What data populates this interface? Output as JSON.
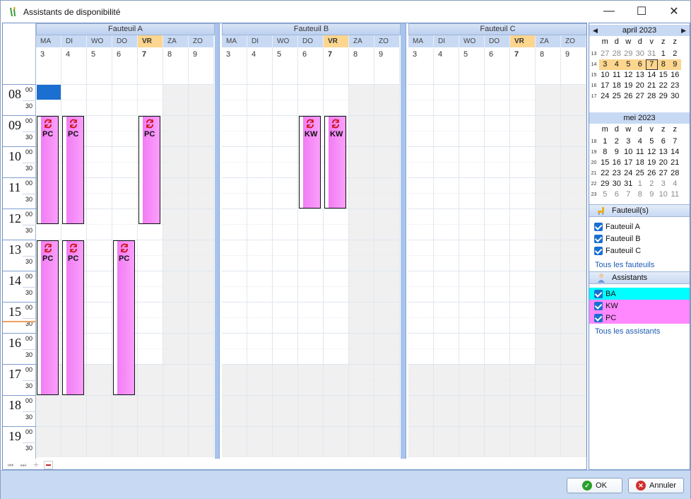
{
  "window": {
    "title": "Assistants de disponibilité",
    "minimize_glyph": "—",
    "maximize_glyph": "☐",
    "close_glyph": "✕"
  },
  "scheduler": {
    "groups": [
      {
        "label": "Fauteuil A"
      },
      {
        "label": "Fauteuil B"
      },
      {
        "label": "Fauteuil C"
      }
    ],
    "days": [
      {
        "abbr": "MA",
        "num": "3",
        "today": false,
        "weekend": false
      },
      {
        "abbr": "DI",
        "num": "4",
        "today": false,
        "weekend": false
      },
      {
        "abbr": "WO",
        "num": "5",
        "today": false,
        "weekend": false
      },
      {
        "abbr": "DO",
        "num": "6",
        "today": false,
        "weekend": false
      },
      {
        "abbr": "VR",
        "num": "7",
        "today": true,
        "weekend": false
      },
      {
        "abbr": "ZA",
        "num": "8",
        "today": false,
        "weekend": true
      },
      {
        "abbr": "ZO",
        "num": "9",
        "today": false,
        "weekend": true
      }
    ],
    "hours": [
      "08",
      "09",
      "10",
      "11",
      "12",
      "13",
      "14",
      "15",
      "16",
      "17",
      "18",
      "19"
    ],
    "minute_top": "00",
    "minute_half": "30",
    "appointments": [
      {
        "group": 0,
        "day": 0,
        "label": "PC",
        "start": "09:00",
        "end": "12:30"
      },
      {
        "group": 0,
        "day": 1,
        "label": "PC",
        "start": "09:00",
        "end": "12:30"
      },
      {
        "group": 0,
        "day": 4,
        "label": "PC",
        "start": "09:00",
        "end": "12:30"
      },
      {
        "group": 0,
        "day": 0,
        "label": "PC",
        "start": "13:00",
        "end": "18:00"
      },
      {
        "group": 0,
        "day": 1,
        "label": "PC",
        "start": "13:00",
        "end": "18:00"
      },
      {
        "group": 0,
        "day": 3,
        "label": "PC",
        "start": "13:00",
        "end": "18:00"
      },
      {
        "group": 1,
        "day": 3,
        "label": "KW",
        "start": "09:00",
        "end": "12:00"
      },
      {
        "group": 1,
        "day": 4,
        "label": "KW",
        "start": "09:00",
        "end": "12:00"
      }
    ]
  },
  "calendars": [
    {
      "title": "april 2023",
      "dow": [
        "m",
        "d",
        "w",
        "d",
        "v",
        "z",
        "z"
      ],
      "weeks": [
        "13",
        "14",
        "15",
        "16",
        "17"
      ],
      "days": [
        {
          "d": "27",
          "s": "dim"
        },
        {
          "d": "28",
          "s": "dim"
        },
        {
          "d": "29",
          "s": "dim"
        },
        {
          "d": "30",
          "s": "dim"
        },
        {
          "d": "31",
          "s": "dim"
        },
        {
          "d": "1",
          "s": ""
        },
        {
          "d": "2",
          "s": ""
        },
        {
          "d": "3",
          "s": "sel"
        },
        {
          "d": "4",
          "s": "sel"
        },
        {
          "d": "5",
          "s": "sel"
        },
        {
          "d": "6",
          "s": "sel"
        },
        {
          "d": "7",
          "s": "cur"
        },
        {
          "d": "8",
          "s": "sel"
        },
        {
          "d": "9",
          "s": "sel"
        },
        {
          "d": "10",
          "s": ""
        },
        {
          "d": "11",
          "s": ""
        },
        {
          "d": "12",
          "s": ""
        },
        {
          "d": "13",
          "s": ""
        },
        {
          "d": "14",
          "s": ""
        },
        {
          "d": "15",
          "s": ""
        },
        {
          "d": "16",
          "s": ""
        },
        {
          "d": "17",
          "s": ""
        },
        {
          "d": "18",
          "s": ""
        },
        {
          "d": "19",
          "s": ""
        },
        {
          "d": "20",
          "s": ""
        },
        {
          "d": "21",
          "s": ""
        },
        {
          "d": "22",
          "s": ""
        },
        {
          "d": "23",
          "s": ""
        },
        {
          "d": "24",
          "s": ""
        },
        {
          "d": "25",
          "s": ""
        },
        {
          "d": "26",
          "s": ""
        },
        {
          "d": "27",
          "s": ""
        },
        {
          "d": "28",
          "s": ""
        },
        {
          "d": "29",
          "s": ""
        },
        {
          "d": "30",
          "s": ""
        }
      ]
    },
    {
      "title": "mei 2023",
      "dow": [
        "m",
        "d",
        "w",
        "d",
        "v",
        "z",
        "z"
      ],
      "weeks": [
        "18",
        "19",
        "20",
        "21",
        "22",
        "23"
      ],
      "days": [
        {
          "d": "1",
          "s": ""
        },
        {
          "d": "2",
          "s": ""
        },
        {
          "d": "3",
          "s": ""
        },
        {
          "d": "4",
          "s": ""
        },
        {
          "d": "5",
          "s": ""
        },
        {
          "d": "6",
          "s": ""
        },
        {
          "d": "7",
          "s": ""
        },
        {
          "d": "8",
          "s": ""
        },
        {
          "d": "9",
          "s": ""
        },
        {
          "d": "10",
          "s": ""
        },
        {
          "d": "11",
          "s": ""
        },
        {
          "d": "12",
          "s": ""
        },
        {
          "d": "13",
          "s": ""
        },
        {
          "d": "14",
          "s": ""
        },
        {
          "d": "15",
          "s": ""
        },
        {
          "d": "16",
          "s": ""
        },
        {
          "d": "17",
          "s": ""
        },
        {
          "d": "18",
          "s": ""
        },
        {
          "d": "19",
          "s": ""
        },
        {
          "d": "20",
          "s": ""
        },
        {
          "d": "21",
          "s": ""
        },
        {
          "d": "22",
          "s": ""
        },
        {
          "d": "23",
          "s": ""
        },
        {
          "d": "24",
          "s": ""
        },
        {
          "d": "25",
          "s": ""
        },
        {
          "d": "26",
          "s": ""
        },
        {
          "d": "27",
          "s": ""
        },
        {
          "d": "28",
          "s": ""
        },
        {
          "d": "29",
          "s": ""
        },
        {
          "d": "30",
          "s": ""
        },
        {
          "d": "31",
          "s": ""
        },
        {
          "d": "1",
          "s": "dim"
        },
        {
          "d": "2",
          "s": "dim"
        },
        {
          "d": "3",
          "s": "dim"
        },
        {
          "d": "4",
          "s": "dim"
        },
        {
          "d": "5",
          "s": "dim"
        },
        {
          "d": "6",
          "s": "dim"
        },
        {
          "d": "7",
          "s": "dim"
        },
        {
          "d": "8",
          "s": "dim"
        },
        {
          "d": "9",
          "s": "dim"
        },
        {
          "d": "10",
          "s": "dim"
        },
        {
          "d": "11",
          "s": "dim"
        }
      ]
    }
  ],
  "chairs": {
    "title": "Fauteuil(s)",
    "items": [
      {
        "label": "Fauteuil A",
        "checked": true
      },
      {
        "label": "Fauteuil B",
        "checked": true
      },
      {
        "label": "Fauteuil C",
        "checked": true
      }
    ],
    "all_link": "Tous les fauteuils"
  },
  "assistants": {
    "title": "Assistants",
    "items": [
      {
        "label": "BA",
        "checked": true,
        "color": "#00ffff"
      },
      {
        "label": "KW",
        "checked": true,
        "color": "#ff88ff"
      },
      {
        "label": "PC",
        "checked": true,
        "color": "#ff88ff"
      }
    ],
    "all_link": "Tous les assistants"
  },
  "footer": {
    "ok_label": "OK",
    "cancel_label": "Annuler"
  },
  "colors": {
    "appointment": "#f37cf5",
    "today_header": "#fcd58e",
    "header_blue": "#c8d9f3",
    "selection": "#1a6fd0"
  }
}
